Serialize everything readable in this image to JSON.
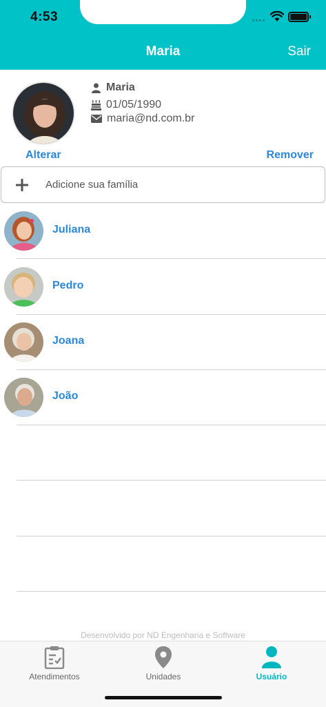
{
  "status_bar": {
    "time": "4:53"
  },
  "header": {
    "title": "Maria",
    "logout_label": "Sair",
    "background": "#00c2c7"
  },
  "profile": {
    "name": "Maria",
    "birthdate": "01/05/1990",
    "email": "maria@nd.com.br",
    "change_label": "Alterar",
    "remove_label": "Remover"
  },
  "add_family": {
    "label": "Adicione sua família"
  },
  "family": [
    {
      "name": "Juliana"
    },
    {
      "name": "Pedro"
    },
    {
      "name": "Joana"
    },
    {
      "name": "João"
    }
  ],
  "footer": {
    "credit": "Desenvolvido por ND Engenharia e Software"
  },
  "tabs": [
    {
      "label": "Atendimentos",
      "icon": "clipboard-icon",
      "active": false
    },
    {
      "label": "Unidades",
      "icon": "map-pin-icon",
      "active": false
    },
    {
      "label": "Usuário",
      "icon": "user-icon",
      "active": true
    }
  ],
  "colors": {
    "accent": "#00c2c7",
    "link": "#2d87d8",
    "active_tab": "#00b7c0"
  }
}
